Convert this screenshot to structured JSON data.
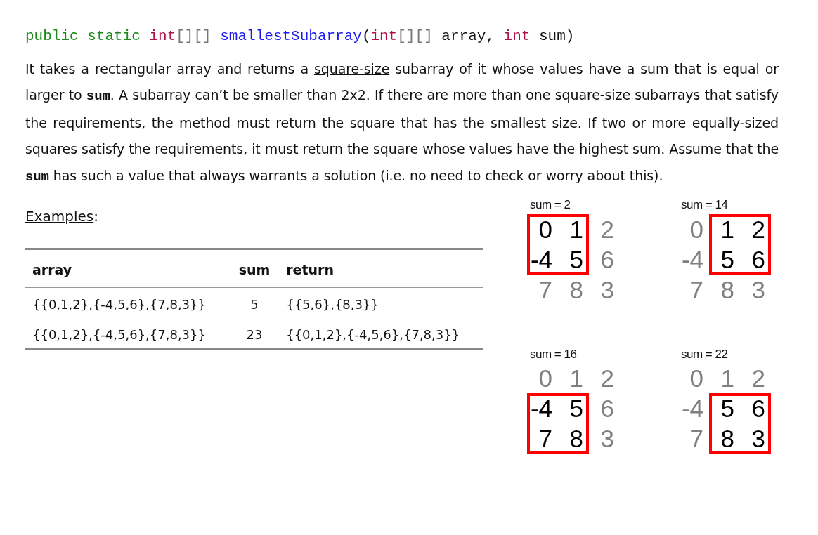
{
  "signature": [
    {
      "text": "public static ",
      "kind": "keyword"
    },
    {
      "text": "int",
      "kind": "type"
    },
    {
      "text": "[][] ",
      "kind": "bracket"
    },
    {
      "text": "smallestSubarray",
      "kind": "method"
    },
    {
      "text": "(",
      "kind": "plain"
    },
    {
      "text": "int",
      "kind": "type"
    },
    {
      "text": "[][] ",
      "kind": "bracket"
    },
    {
      "text": "array, ",
      "kind": "plain"
    },
    {
      "text": "int",
      "kind": "type"
    },
    {
      "text": " sum)",
      "kind": "plain"
    }
  ],
  "description": [
    {
      "text": "It takes a rectangular array and returns a ",
      "kind": "plain"
    },
    {
      "text": "square-size",
      "kind": "underlined"
    },
    {
      "text": " subarray of it whose values have a sum that is equal or larger to ",
      "kind": "plain"
    },
    {
      "text": "sum",
      "kind": "code"
    },
    {
      "text": ". A subarray can’t be smaller than 2x2. If there are more than one square-size subarrays that satisfy the requirements, the method must return the square that has the smallest size. If two or more equally-sized squares satisfy the requirements, it must return the square whose values have the highest sum. Assume that the ",
      "kind": "plain"
    },
    {
      "text": "sum",
      "kind": "code"
    },
    {
      "text": " has such a value that always warrants a solution (i.e. no need to check or worry about this).",
      "kind": "plain"
    }
  ],
  "examples_heading": {
    "label": "Examples",
    "suffix": ":"
  },
  "table": {
    "columns": [
      "array",
      "sum",
      "return"
    ],
    "rows": [
      [
        "{{0,1,2},{-4,5,6},{7,8,3}}",
        "5",
        "{{5,6},{8,3}}"
      ],
      [
        "{{0,1,2},{-4,5,6},{7,8,3}}",
        "23",
        "{{0,1,2},{-4,5,6},{7,8,3}}"
      ]
    ]
  },
  "diagrams": [
    {
      "label": "sum = 2",
      "cells": [
        [
          {
            "value": "0",
            "selected": true
          },
          {
            "value": "1",
            "selected": true
          },
          {
            "value": "2",
            "selected": false
          }
        ],
        [
          {
            "value": "-4",
            "selected": true
          },
          {
            "value": "5",
            "selected": true
          },
          {
            "value": "6",
            "selected": false
          }
        ],
        [
          {
            "value": "7",
            "selected": false
          },
          {
            "value": "8",
            "selected": false
          },
          {
            "value": "3",
            "selected": false
          }
        ]
      ]
    },
    {
      "label": "sum = 14",
      "cells": [
        [
          {
            "value": "0",
            "selected": false
          },
          {
            "value": "1",
            "selected": true
          },
          {
            "value": "2",
            "selected": true
          }
        ],
        [
          {
            "value": "-4",
            "selected": false
          },
          {
            "value": "5",
            "selected": true
          },
          {
            "value": "6",
            "selected": true
          }
        ],
        [
          {
            "value": "7",
            "selected": false
          },
          {
            "value": "8",
            "selected": false
          },
          {
            "value": "3",
            "selected": false
          }
        ]
      ]
    },
    {
      "label": "sum = 16",
      "cells": [
        [
          {
            "value": "0",
            "selected": false
          },
          {
            "value": "1",
            "selected": false
          },
          {
            "value": "2",
            "selected": false
          }
        ],
        [
          {
            "value": "-4",
            "selected": true
          },
          {
            "value": "5",
            "selected": true
          },
          {
            "value": "6",
            "selected": false
          }
        ],
        [
          {
            "value": "7",
            "selected": true
          },
          {
            "value": "8",
            "selected": true
          },
          {
            "value": "3",
            "selected": false
          }
        ]
      ]
    },
    {
      "label": "sum = 22",
      "cells": [
        [
          {
            "value": "0",
            "selected": false
          },
          {
            "value": "1",
            "selected": false
          },
          {
            "value": "2",
            "selected": false
          }
        ],
        [
          {
            "value": "-4",
            "selected": false
          },
          {
            "value": "5",
            "selected": true
          },
          {
            "value": "6",
            "selected": true
          }
        ],
        [
          {
            "value": "7",
            "selected": false
          },
          {
            "value": "8",
            "selected": true
          },
          {
            "value": "3",
            "selected": true
          }
        ]
      ]
    }
  ]
}
